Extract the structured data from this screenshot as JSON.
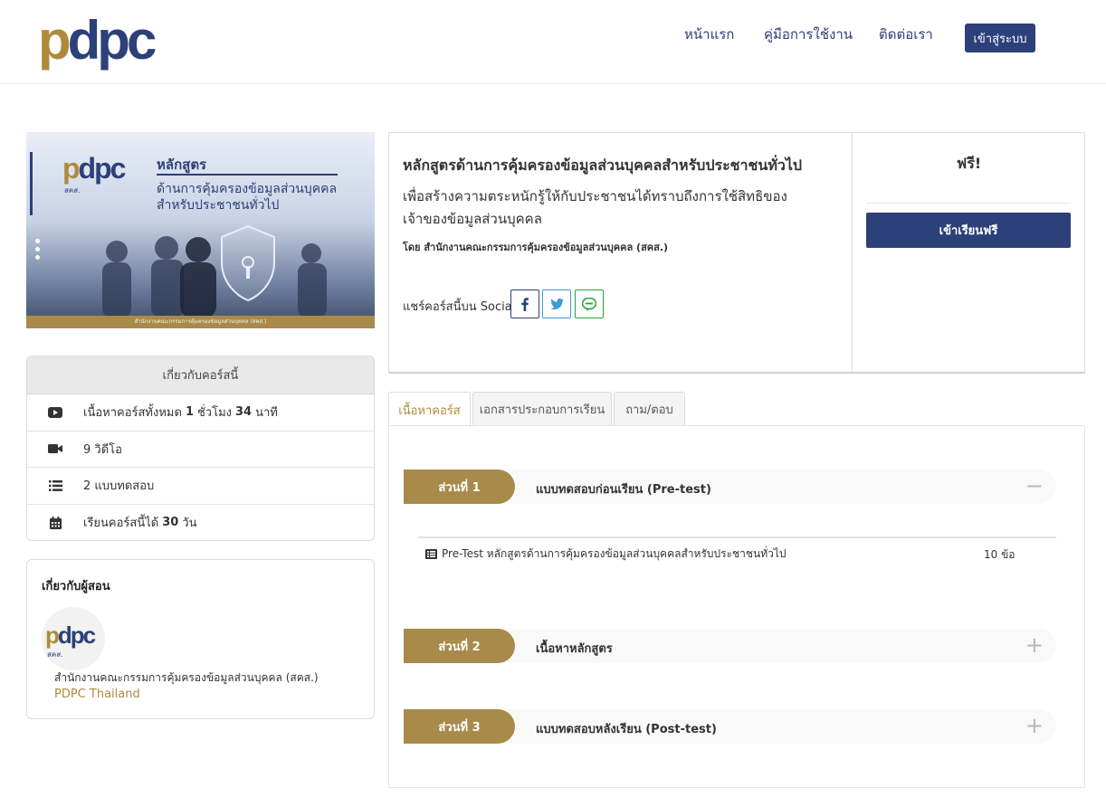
{
  "header": {
    "logo_text_a": "p",
    "logo_text_b": "dpc",
    "nav": {
      "home": "หน้าแรก",
      "manual": "คู่มือการใช้งาน",
      "contact": "ติดต่อเรา"
    },
    "login_label": "เข้าสู่ระบบ"
  },
  "banner": {
    "logo_sub": "สคส.",
    "title": "หลักสูตร",
    "subtitle_1": "ด้านการคุ้มครองข้อมูลส่วนบุคคล",
    "subtitle_2": "สำหรับประชาชนทั่วไป",
    "footer": "สำนักงานคณะกรรมการคุ้มครองข้อมูลส่วนบุคคล (สคส.)"
  },
  "about_course": {
    "heading": "เกี่ยวกับคอร์สนี้",
    "duration_prefix": "เนื้อหาคอร์สทั้งหมด",
    "duration_hours": "1",
    "duration_hours_unit": "ชั่วโมง",
    "duration_minutes": "34",
    "duration_minutes_unit": "นาที",
    "videos": "9 วิดีโอ",
    "quizzes": "2 แบบทดสอบ",
    "access_prefix": "เรียนคอร์สนี้ได้",
    "access_days": "30",
    "access_unit": "วัน"
  },
  "instructor": {
    "heading": "เกี่ยวกับผู้สอน",
    "avatar_sub": "สคส.",
    "name": "สำนักงานคณะกรรมการคุ้มครองข้อมูลส่วนบุคคล (สคส.)",
    "link": "PDPC Thailand"
  },
  "course": {
    "title": "หลักสูตรด้านการคุ้มครองข้อมูลส่วนบุคคลสำหรับประชาชนทั่วไป",
    "description": "เพื่อสร้างความตระหนักรู้ให้กับประชาชนได้ทราบถึงการใช้สิทธิของเจ้าของข้อมูลส่วนบุคคล",
    "by": "โดย สำนักงานคณะกรรมการคุ้มครองข้อมูลส่วนบุคคล (สคส.)",
    "share_label": "แชร์คอร์สนี้บน Social:",
    "price": "ฟรี!",
    "enroll_label": "เข้าเรียนฟรี"
  },
  "tabs": [
    "เนื้อหาคอร์ส",
    "เอกสารประกอบการเรียน",
    "ถาม/ตอบ"
  ],
  "sections": [
    {
      "label": "ส่วนที่ 1",
      "title": "แบบทดสอบก่อนเรียน (Pre-test)",
      "toggle": "−"
    },
    {
      "label": "ส่วนที่ 2",
      "title": "เนื้อหาหลักสูตร",
      "toggle": "+"
    },
    {
      "label": "ส่วนที่ 3",
      "title": "แบบทดสอบหลังเรียน (Post-test)",
      "toggle": "+"
    }
  ],
  "lesson": {
    "title": "Pre-Test หลักสูตรด้านการคุ้มครองข้อมูลส่วนบุคคลสำหรับประชาชนทั่วไป",
    "count": "10 ข้อ"
  },
  "colors": {
    "primary": "#2c4079",
    "gold": "#a88a4a",
    "facebook": "#2c4079",
    "twitter": "#3b9ad9",
    "line": "#22a53a"
  }
}
